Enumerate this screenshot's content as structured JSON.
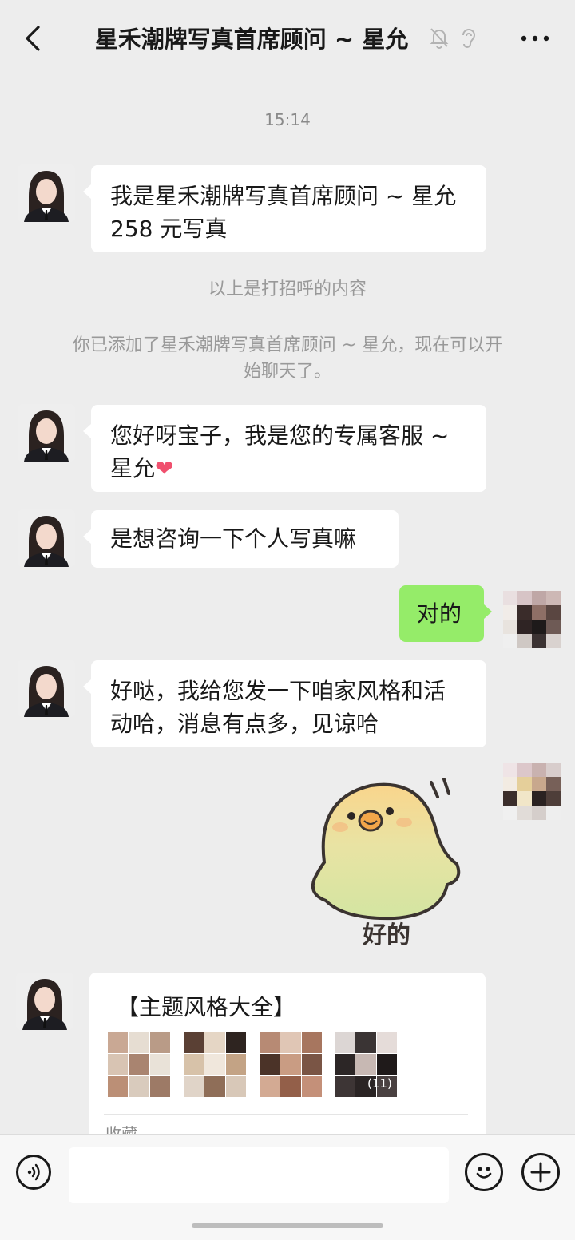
{
  "header": {
    "title": "星禾潮牌写真首席顾问 ~ 星允",
    "icons": [
      "back-icon",
      "mute-bell-icon",
      "ear-icon",
      "more-icon"
    ]
  },
  "chat": {
    "timestamp": "15:14",
    "greeting_bubble": "我是星禾潮牌写真首席顾问 ~ 星允\n258 元写真",
    "system_note_1": "以上是打招呼的内容",
    "system_note_2_line1": "你已添加了星禾潮牌写真首席顾问 ~ 星允，现在可以开",
    "system_note_2_line2": "始聊天了。",
    "msg_1_text": "您好呀宝子，我是您的专属客服 ~\n星允",
    "msg_1_emoji": "❤",
    "msg_2": "是想咨询一下个人写真嘛",
    "reply_1": "对的",
    "msg_3": "好哒，我给您发一下咱家风格和活\n动哈，消息有点多，见谅哈",
    "sticker_caption": "好的",
    "card": {
      "title": "【主题风格大全】",
      "thumb_count_badge": "(11)",
      "source": "收藏"
    }
  },
  "input_bar": {
    "icons": [
      "voice-icon",
      "emoji-icon",
      "plus-icon"
    ]
  },
  "colors": {
    "bg": "#ededed",
    "out_bubble": "#95ec69",
    "in_bubble": "#ffffff",
    "system_text": "#999999"
  }
}
